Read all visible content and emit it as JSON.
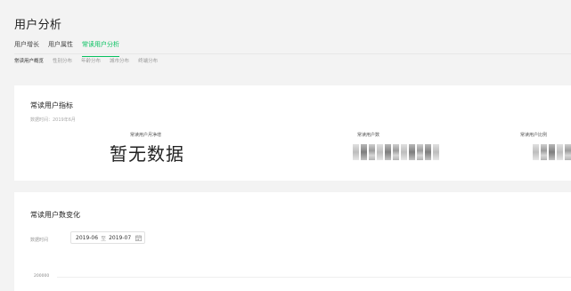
{
  "page": {
    "title": "用户分析"
  },
  "tabs": [
    {
      "label": "用户增长"
    },
    {
      "label": "用户属性"
    },
    {
      "label": "常读用户分析"
    }
  ],
  "subtabs": [
    {
      "label": "常读用户概览"
    },
    {
      "label": "性别分布"
    },
    {
      "label": "年龄分布"
    },
    {
      "label": "城市分布"
    },
    {
      "label": "终端分布"
    }
  ],
  "metrics_card": {
    "title": "常读用户指标",
    "data_time": "数据时间：2019年6月",
    "metrics": [
      {
        "label": "常读用户月净增",
        "value": "暂无数据"
      },
      {
        "label": "常读用户数",
        "value": ""
      },
      {
        "label": "常读用户比例",
        "value": ""
      }
    ]
  },
  "trend_card": {
    "title": "常读用户数变化",
    "date_label": "数据时间",
    "date_start": "2019-06",
    "date_separator": "至",
    "date_end": "2019-07",
    "y_tick": "200000"
  },
  "colors": {
    "accent": "#07c160",
    "background": "#f3f3f3",
    "card": "#ffffff"
  },
  "icons": {
    "calendar": "calendar-icon"
  }
}
